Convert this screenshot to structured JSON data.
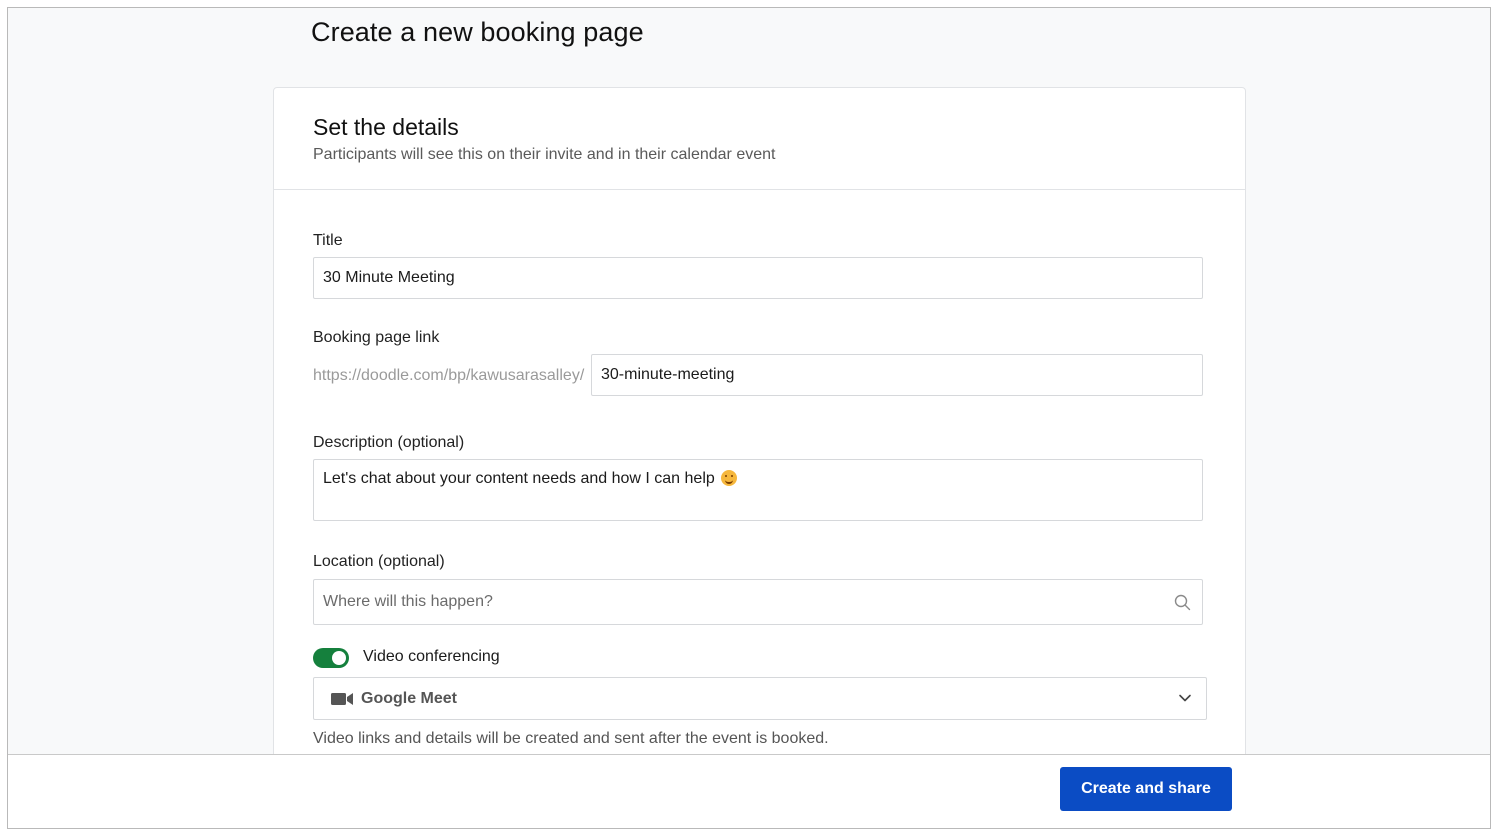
{
  "page": {
    "title": "Create a new booking page"
  },
  "card": {
    "heading": "Set the details",
    "subheading": "Participants will see this on their invite and in their calendar event"
  },
  "form": {
    "title_label": "Title",
    "title_value": "30 Minute Meeting",
    "link_label": "Booking page link",
    "link_prefix": "https://doodle.com/bp/kawusarasalley/",
    "link_slug": "30-minute-meeting",
    "description_label": "Description (optional)",
    "description_value": "Let's chat about your content needs and how I can help",
    "location_label": "Location (optional)",
    "location_placeholder": "Where will this happen?",
    "video_toggle_label": "Video conferencing",
    "video_toggle_on": true,
    "video_provider": "Google Meet",
    "video_hint": "Video links and details will be created and sent after the event is booked."
  },
  "footer": {
    "primary_label": "Create and share"
  },
  "colors": {
    "accent": "#0b4cc4",
    "toggle_on": "#15803d"
  },
  "icons": [
    "search-icon",
    "video-camera-icon",
    "chevron-down-icon",
    "smile-emoji-icon"
  ]
}
